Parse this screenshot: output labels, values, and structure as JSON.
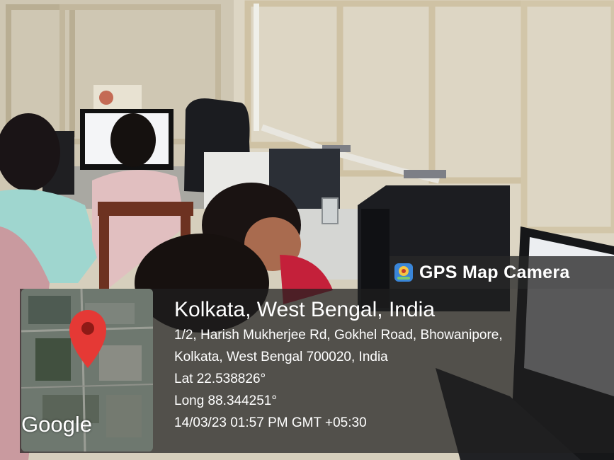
{
  "gps_overlay": {
    "app_title": "GPS Map Camera",
    "city_line": "Kolkata, West Bengal, India",
    "address_line_1": "1/2, Harish Mukherjee Rd, Gokhel Road, Bhowanipore,",
    "address_line_2": "Kolkata, West Bengal 700020, India",
    "latitude": "Lat 22.538826°",
    "longitude": "Long 88.344251°",
    "timestamp": "14/03/23 01:57 PM GMT +05:30",
    "map_attribution": "Google",
    "icons": [
      "camera-app-icon",
      "map-pin-icon"
    ]
  },
  "colors": {
    "overlay": "#1e1e1e",
    "pin": "#e53935",
    "text": "#ffffff"
  }
}
